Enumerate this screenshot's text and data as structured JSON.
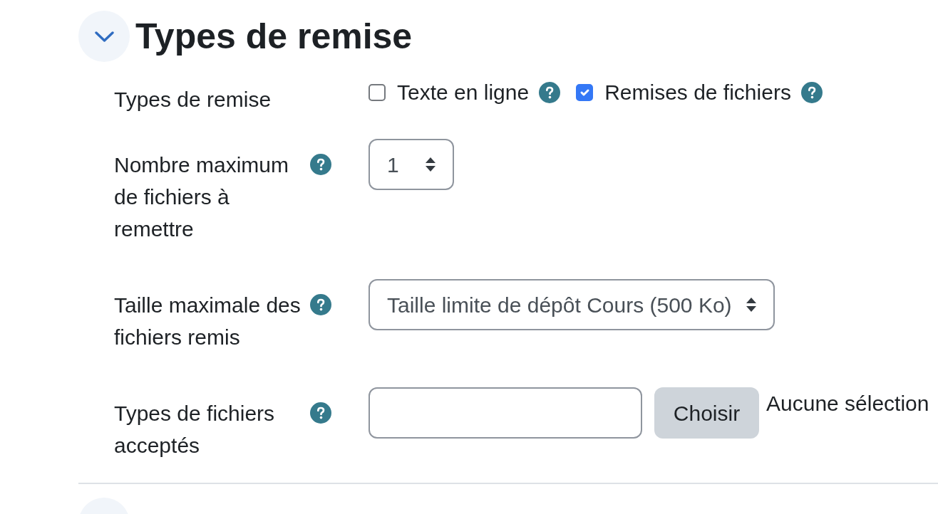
{
  "sections": [
    {
      "title": "Types de remise",
      "expanded": true,
      "fields": [
        {
          "kind": "checkboxes",
          "label": "Types de remise",
          "help": false,
          "options": [
            {
              "label": "Texte en ligne",
              "checked": false,
              "help": true
            },
            {
              "label": "Remises de fichiers",
              "checked": true,
              "help": true
            }
          ]
        },
        {
          "kind": "select",
          "label": "Nombre maximum de fichiers à remettre",
          "help": true,
          "value": "1"
        },
        {
          "kind": "select",
          "label": "Taille maximale des fichiers remis",
          "help": true,
          "value": "Taille limite de dépôt Cours (500 Ko)"
        },
        {
          "kind": "file_types",
          "label": "Types de fichiers acceptés",
          "help": true,
          "button": "Choisir",
          "selection": "Aucune sélection"
        }
      ]
    },
    {
      "expanded": false
    }
  ]
}
